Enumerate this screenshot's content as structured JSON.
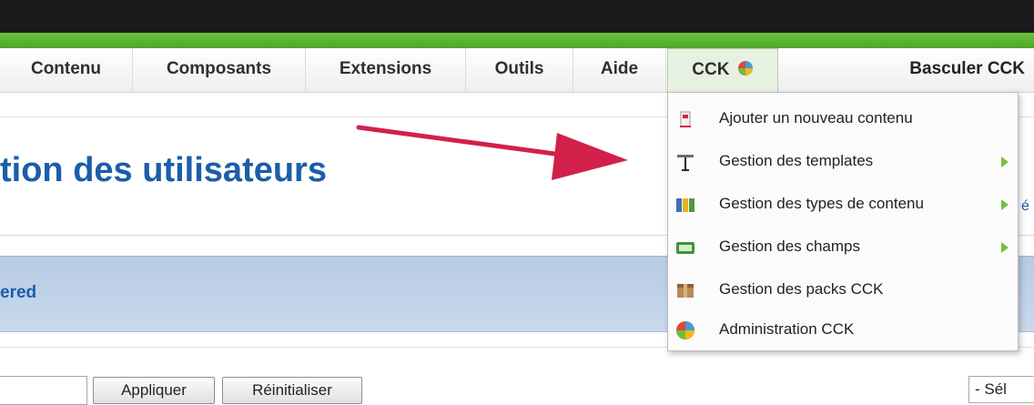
{
  "menu": {
    "items": [
      "Contenu",
      "Composants",
      "Extensions",
      "Outils",
      "Aide",
      "CCK"
    ],
    "switch_label": "Basculer CCK"
  },
  "page": {
    "title": "tion des utilisateurs",
    "band_text": "ered",
    "cut_text": "é"
  },
  "toolbar": {
    "apply_label": "Appliquer",
    "reset_label": "Réinitialiser",
    "select_value": "- Sél"
  },
  "dropdown": {
    "items": [
      {
        "label": "Ajouter un nouveau contenu",
        "icon": "add-content-icon",
        "submenu": false
      },
      {
        "label": "Gestion des templates",
        "icon": "template-icon",
        "submenu": true
      },
      {
        "label": "Gestion des types de contenu",
        "icon": "content-types-icon",
        "submenu": true
      },
      {
        "label": "Gestion des champs",
        "icon": "fields-icon",
        "submenu": true
      },
      {
        "label": "Gestion des packs CCK",
        "icon": "packs-icon",
        "submenu": false
      },
      {
        "label": "Administration CCK",
        "icon": "cck-logo-icon",
        "submenu": false
      }
    ]
  },
  "colors": {
    "accent_green": "#5cb531",
    "title_blue": "#1a5ea8",
    "arrow_red": "#d2204a"
  }
}
